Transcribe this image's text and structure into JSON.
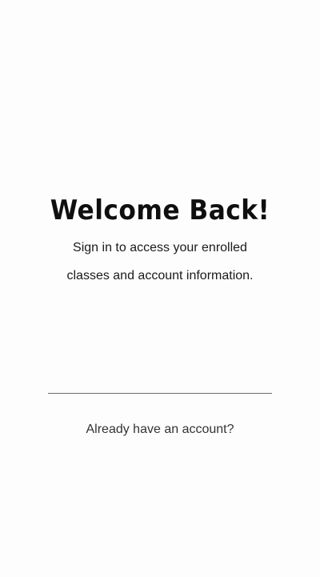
{
  "welcome": {
    "title": "Welcome Back!",
    "subtitle_line1": "Sign in to access your enrolled",
    "subtitle_line2": "classes and account information."
  },
  "footer": {
    "account_prompt": "Already have an account?"
  }
}
